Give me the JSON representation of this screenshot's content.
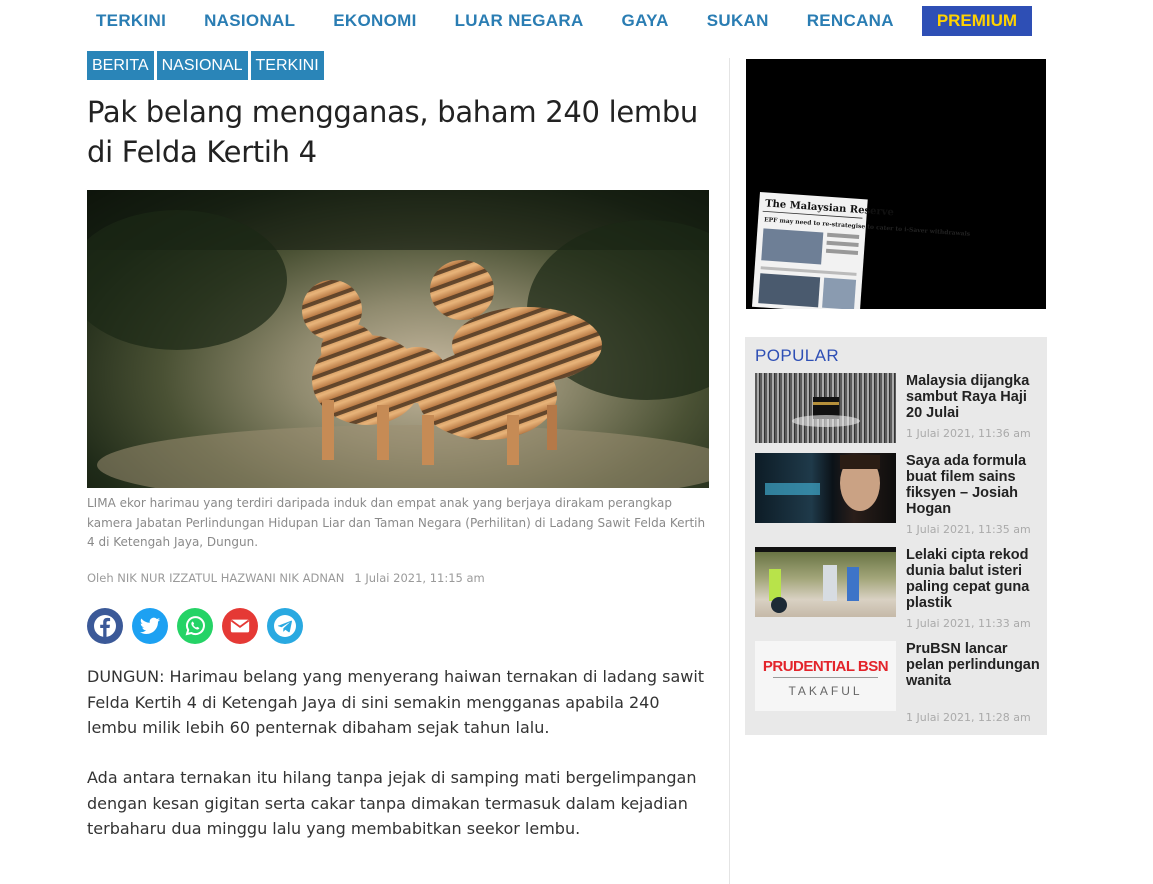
{
  "nav": {
    "items": [
      "TERKINI",
      "NASIONAL",
      "EKONOMI",
      "LUAR NEGARA",
      "GAYA",
      "SUKAN",
      "RENCANA"
    ],
    "premium": "PREMIUM"
  },
  "tags": [
    "BERITA",
    "NASIONAL",
    "TERKINI"
  ],
  "article": {
    "title": "Pak belang mengganas, baham 240 lembu di Felda Kertih 4",
    "caption": "LIMA ekor harimau yang terdiri daripada induk dan empat anak yang berjaya dirakam perangkap kamera Jabatan Perlindungan Hidupan Liar dan Taman Negara (Perhilitan) di Ladang Sawit Felda Kertih 4 di Ketengah Jaya, Dungun.",
    "byline": "Oleh NIK NUR IZZATUL HAZWANI NIK ADNAN",
    "date": "1 Julai 2021, 11:15 am",
    "paragraphs": [
      "DUNGUN: Harimau belang yang menyerang haiwan ternakan di ladang sawit Felda Kertih 4 di Ketengah Jaya di sini semakin mengganas apabila 240 lembu milik lebih 60 penternak dibaham sejak tahun lalu.",
      "Ada antara ternakan itu hilang tanpa jejak di samping mati bergelimpangan dengan kesan gigitan serta cakar tanpa dimakan termasuk dalam kejadian terbaharu dua minggu lalu yang membabitkan seekor lembu."
    ]
  },
  "share": {
    "icons": [
      "facebook-icon",
      "twitter-icon",
      "whatsapp-icon",
      "email-icon",
      "telegram-icon"
    ],
    "colors": [
      "#3b5998",
      "#1da1f2",
      "#25d366",
      "#e53935",
      "#29a9e1"
    ]
  },
  "ad": {
    "newspaper_name": "The Malaysian Reserve",
    "headline": "EPF may need to re-strategise to cater to i-Saver withdrawals"
  },
  "popular": {
    "heading": "POPULAR",
    "items": [
      {
        "title": "Malaysia dijangka sambut Raya Haji 20 Julai",
        "time": "1 Julai 2021, 11:36 am"
      },
      {
        "title": "Saya ada formula buat filem sains fiksyen – Josiah Hogan",
        "time": "1 Julai 2021, 11:35 am"
      },
      {
        "title": "Lelaki cipta rekod dunia balut isteri paling cepat guna plastik",
        "time": "1 Julai 2021, 11:33 am"
      },
      {
        "title": "PruBSN lancar pelan perlindungan wanita",
        "time": "1 Julai 2021, 11:28 am"
      }
    ],
    "thumb4_logo_top": "PRUDENTIAL BSN",
    "thumb4_logo_bottom": "TAKAFUL"
  }
}
